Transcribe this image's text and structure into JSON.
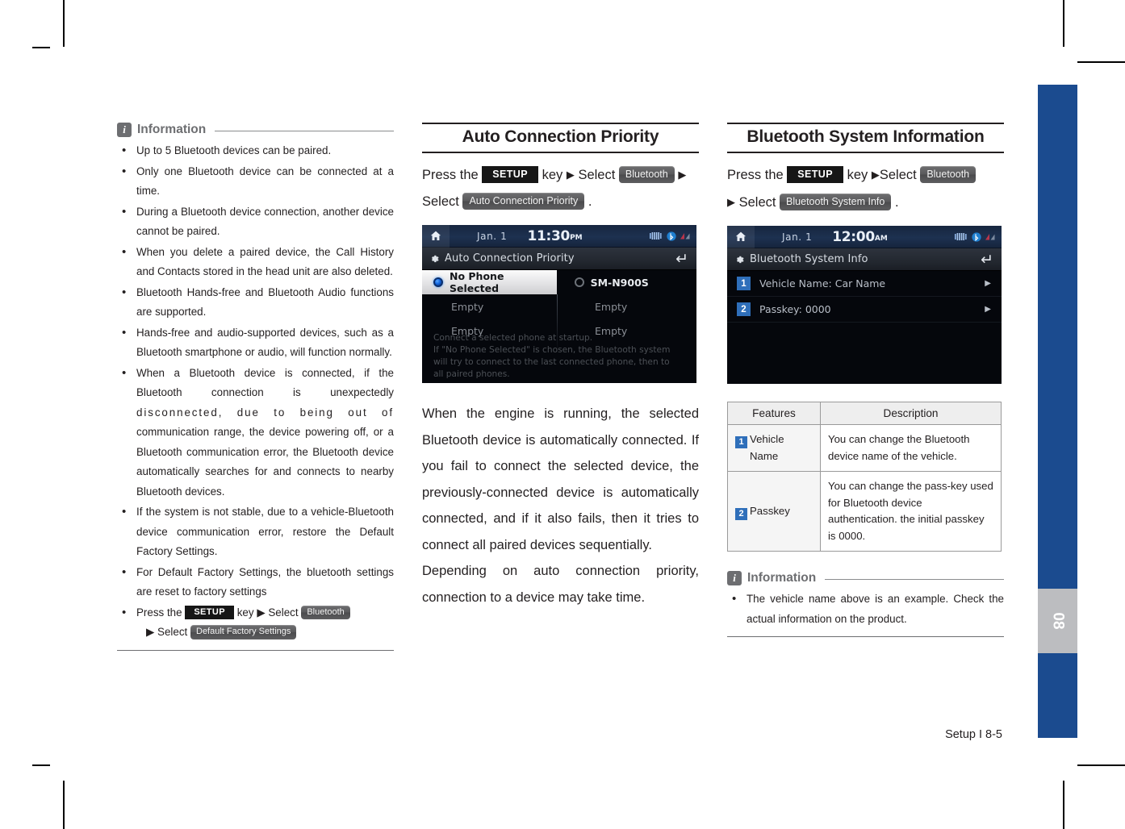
{
  "page": {
    "footer": "Setup I 8-5",
    "side_tab_number": "08",
    "side_tab_color": "#1b4b8f",
    "side_tab_marker_color": "#bcbdc0"
  },
  "left_column": {
    "info": {
      "icon": "info-icon",
      "title": "Information",
      "bullets": [
        "Up to 5 Bluetooth devices can be paired.",
        "Only one Bluetooth device can be connected at a time.",
        "During a Bluetooth device connection, another device cannot be paired.",
        "When you delete a paired device, the Call History and Contacts stored in the head unit are also deleted.",
        "Bluetooth Hands-free and Bluetooth Audio functions are supported.",
        "Hands-free and audio-supported devices, such as a Bluetooth smartphone or audio, will function normally.",
        "When a Bluetooth device is connected, if the Bluetooth connection is unexpectedly",
        "If the system is not stable, due to a vehicle-Bluetooth device communication error, restore the Default Factory Settings.",
        "For Default Factory Settings, the bluetooth settings are reset to factory settings"
      ],
      "bullet7_spread": "disconnected, due to being out of",
      "bullet7_tail": "communication range, the device powering off, or a Bluetooth communication error, the Bluetooth device automatically searches for and connects to nearby Bluetooth devices.",
      "last_bullet": {
        "press_the": "Press the",
        "setup_key": "SETUP",
        "key_word": "key",
        "arrow": "▶",
        "select": "Select",
        "bluetooth": "Bluetooth",
        "select2": "Select",
        "default_factory": "Default Factory Settings"
      }
    }
  },
  "middle_column": {
    "heading": "Auto Connection Priority",
    "instruction": {
      "press_the": "Press the",
      "setup_key": "SETUP",
      "key_word": "key",
      "arrow": "▶",
      "select": "Select",
      "bluetooth": "Bluetooth",
      "select2": "Select",
      "menu_item": "Auto Connection Priority",
      "period": "."
    },
    "screenshot": {
      "statusbar": {
        "home_icon": "home-icon",
        "date": "Jan.  1",
        "time": "11:30",
        "ampm": "PM",
        "icons": [
          "signal-bars-icon",
          "bluetooth-audio-icon",
          "antenna-icon"
        ]
      },
      "title": "Auto Connection Priority",
      "title_icon": "gear-icon",
      "back_icon": "back-arrow-icon",
      "list": [
        {
          "label": "No Phone Selected",
          "selected": true,
          "column": "left"
        },
        {
          "label": "SM-N900S",
          "selected": false,
          "column": "right"
        },
        {
          "label": "Empty",
          "selected": false,
          "column": "left"
        },
        {
          "label": "Empty",
          "selected": false,
          "column": "right"
        },
        {
          "label": "Empty",
          "selected": false,
          "column": "left"
        },
        {
          "label": "Empty",
          "selected": false,
          "column": "right"
        }
      ],
      "note": [
        "Connect a selected phone at startup.",
        "If \"No Phone Selected\" is chosen, the Bluetooth system",
        "will try to connect to the last connected phone, then to",
        "all paired phones."
      ]
    },
    "body_paragraphs": [
      "When the engine is running, the selected Bluetooth device is automatically connected. If you fail to connect the selected device, the previously-connected device is automatically connected, and if it also fails, then it tries to connect all paired devices sequentially.",
      "Depending on auto connection priority, connection to a device may take time."
    ]
  },
  "right_column": {
    "heading": "Bluetooth System Information",
    "instruction": {
      "press_the": "Press the",
      "setup_key": "SETUP",
      "key_word": "key",
      "arrow": "▶",
      "select": "Select",
      "bluetooth": "Bluetooth",
      "select2": "Select",
      "menu_item": "Bluetooth System Info",
      "period": "."
    },
    "screenshot": {
      "statusbar": {
        "home_icon": "home-icon",
        "date": "Jan.  1",
        "time": "12:00",
        "ampm": "AM",
        "icons": [
          "signal-bars-icon",
          "bluetooth-audio-icon",
          "antenna-icon"
        ]
      },
      "title": "Bluetooth System Info",
      "title_icon": "gear-icon",
      "back_icon": "back-arrow-icon",
      "rows": [
        {
          "num": "1",
          "label": "Vehicle Name: Car Name",
          "arrow": "▶"
        },
        {
          "num": "2",
          "label": "Passkey: 0000",
          "arrow": "▶"
        }
      ]
    },
    "table": {
      "headers": [
        "Features",
        "Description"
      ],
      "rows": [
        {
          "num": "1",
          "feature_line1": "Vehicle",
          "feature_line2": "Name",
          "description": "You can change the Bluetooth device name of the vehicle."
        },
        {
          "num": "2",
          "feature_line1": "Passkey",
          "feature_line2": "",
          "description": "You can change the pass-key used for Bluetooth device authentication. the initial passkey is 0000."
        }
      ]
    },
    "info": {
      "icon": "info-icon",
      "title": "Information",
      "bullets": [
        "The vehicle name above is an example. Check the actual information on the product."
      ]
    }
  }
}
